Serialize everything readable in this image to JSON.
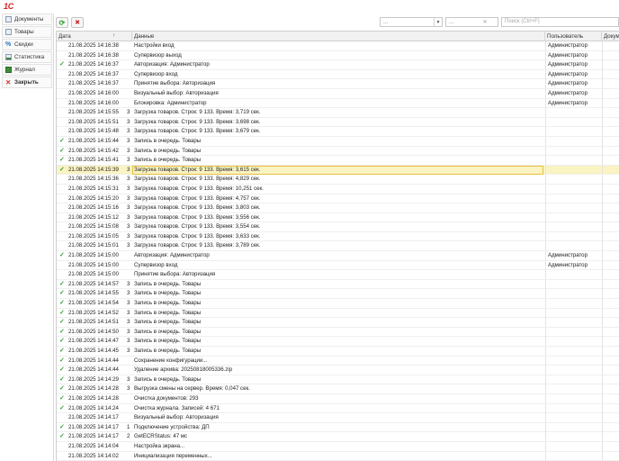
{
  "app": {
    "logo_text": "1С"
  },
  "sidebar": {
    "items": [
      {
        "label": "Документы",
        "icon": "documents-icon"
      },
      {
        "label": "Товары",
        "icon": "goods-icon"
      },
      {
        "label": "Скидки",
        "icon": "percent-icon"
      },
      {
        "label": "Статистика",
        "icon": "chart-icon"
      },
      {
        "label": "Журнал",
        "icon": "journal-icon"
      },
      {
        "label": "Закрыть",
        "icon": "close-icon"
      }
    ]
  },
  "toolbar": {
    "filter1_value": "...",
    "filter2_value": "...",
    "search_placeholder": "Поиск (Ctrl+F)"
  },
  "table": {
    "columns": {
      "date": "Дата",
      "data": "Данные",
      "user": "Пользователь",
      "doc": "Докуме"
    },
    "sort_indicator": "↑",
    "rows": [
      {
        "check": false,
        "date": "21.08.2025 14:16:38",
        "code": "",
        "data": "Настройки вход",
        "user": "Администратор"
      },
      {
        "check": false,
        "date": "21.08.2025 14:16:38",
        "code": "",
        "data": "Супервизор выход",
        "user": "Администратор"
      },
      {
        "check": true,
        "date": "21.08.2025 14:16:37",
        "code": "",
        "data": "Авторизация: Администратор",
        "user": "Администратор"
      },
      {
        "check": false,
        "date": "21.08.2025 14:16:37",
        "code": "",
        "data": "Супервизор вход",
        "user": "Администратор"
      },
      {
        "check": false,
        "date": "21.08.2025 14:16:37",
        "code": "",
        "data": "Принятие выбора: Авторизация",
        "user": "Администратор"
      },
      {
        "check": false,
        "date": "21.08.2025 14:16:00",
        "code": "",
        "data": "Визуальный выбор: Авторизация",
        "user": "Администратор"
      },
      {
        "check": false,
        "date": "21.08.2025 14:16:00",
        "code": "",
        "data": "Блокировка: Администратор",
        "user": "Администратор"
      },
      {
        "check": false,
        "date": "21.08.2025 14:15:55",
        "code": "3",
        "data": "Загрузка товаров. Строк: 9 133. Время: 3,719 сек.",
        "user": ""
      },
      {
        "check": false,
        "date": "21.08.2025 14:15:51",
        "code": "3",
        "data": "Загрузка товаров. Строк: 9 133. Время: 3,698 сек.",
        "user": ""
      },
      {
        "check": false,
        "date": "21.08.2025 14:15:48",
        "code": "3",
        "data": "Загрузка товаров. Строк: 9 133. Время: 3,679 сек.",
        "user": ""
      },
      {
        "check": true,
        "date": "21.08.2025 14:15:44",
        "code": "3",
        "data": "Запись в очередь. Товары",
        "user": ""
      },
      {
        "check": true,
        "date": "21.08.2025 14:15:42",
        "code": "3",
        "data": "Запись в очередь. Товары",
        "user": ""
      },
      {
        "check": true,
        "date": "21.08.2025 14:15:41",
        "code": "3",
        "data": "Запись в очередь. Товары",
        "user": ""
      },
      {
        "check": true,
        "date": "21.08.2025 14:15:39",
        "code": "3",
        "data": "Загрузка товаров. Строк: 9 133. Время: 3,615 сек.",
        "user": "",
        "selected": true
      },
      {
        "check": false,
        "date": "21.08.2025 14:15:36",
        "code": "3",
        "data": "Загрузка товаров. Строк: 9 133. Время: 4,829 сек.",
        "user": ""
      },
      {
        "check": false,
        "date": "21.08.2025 14:15:31",
        "code": "3",
        "data": "Загрузка товаров. Строк: 9 133. Время: 10,251 сек.",
        "user": ""
      },
      {
        "check": false,
        "date": "21.08.2025 14:15:20",
        "code": "3",
        "data": "Загрузка товаров. Строк: 9 133. Время: 4,757 сек.",
        "user": ""
      },
      {
        "check": false,
        "date": "21.08.2025 14:15:16",
        "code": "3",
        "data": "Загрузка товаров. Строк: 9 133. Время: 3,803 сек.",
        "user": ""
      },
      {
        "check": false,
        "date": "21.08.2025 14:15:12",
        "code": "3",
        "data": "Загрузка товаров. Строк: 9 133. Время: 3,556 сек.",
        "user": ""
      },
      {
        "check": false,
        "date": "21.08.2025 14:15:08",
        "code": "3",
        "data": "Загрузка товаров. Строк: 9 133. Время: 3,554 сек.",
        "user": ""
      },
      {
        "check": false,
        "date": "21.08.2025 14:15:05",
        "code": "3",
        "data": "Загрузка товаров. Строк: 9 133. Время: 3,633 сек.",
        "user": ""
      },
      {
        "check": false,
        "date": "21.08.2025 14:15:01",
        "code": "3",
        "data": "Загрузка товаров. Строк: 9 133. Время: 3,789 сек.",
        "user": ""
      },
      {
        "check": true,
        "date": "21.08.2025 14:15:00",
        "code": "",
        "data": "Авторизация: Администратор",
        "user": "Администратор"
      },
      {
        "check": false,
        "date": "21.08.2025 14:15:00",
        "code": "",
        "data": "Супервизор вход",
        "user": "Администратор"
      },
      {
        "check": false,
        "date": "21.08.2025 14:15:00",
        "code": "",
        "data": "Принятие выбора: Авторизация",
        "user": ""
      },
      {
        "check": true,
        "date": "21.08.2025 14:14:57",
        "code": "3",
        "data": "Запись в очередь. Товары",
        "user": ""
      },
      {
        "check": true,
        "date": "21.08.2025 14:14:55",
        "code": "3",
        "data": "Запись в очередь. Товары",
        "user": ""
      },
      {
        "check": true,
        "date": "21.08.2025 14:14:54",
        "code": "3",
        "data": "Запись в очередь. Товары",
        "user": ""
      },
      {
        "check": true,
        "date": "21.08.2025 14:14:52",
        "code": "3",
        "data": "Запись в очередь. Товары",
        "user": ""
      },
      {
        "check": true,
        "date": "21.08.2025 14:14:51",
        "code": "3",
        "data": "Запись в очередь. Товары",
        "user": ""
      },
      {
        "check": true,
        "date": "21.08.2025 14:14:50",
        "code": "3",
        "data": "Запись в очередь. Товары",
        "user": ""
      },
      {
        "check": true,
        "date": "21.08.2025 14:14:47",
        "code": "3",
        "data": "Запись в очередь. Товары",
        "user": ""
      },
      {
        "check": true,
        "date": "21.08.2025 14:14:45",
        "code": "3",
        "data": "Запись в очередь. Товары",
        "user": ""
      },
      {
        "check": true,
        "date": "21.08.2025 14:14:44",
        "code": "",
        "data": "Сохранение конфигурации...",
        "user": ""
      },
      {
        "check": true,
        "date": "21.08.2025 14:14:44",
        "code": "",
        "data": "Удаление архива: 20250818005336.zip",
        "user": ""
      },
      {
        "check": true,
        "date": "21.08.2025 14:14:29",
        "code": "3",
        "data": "Запись в очередь. Товары",
        "user": ""
      },
      {
        "check": true,
        "date": "21.08.2025 14:14:28",
        "code": "3",
        "data": "Выгрузка смены на сервер. Время: 0,047 сек.",
        "user": ""
      },
      {
        "check": true,
        "date": "21.08.2025 14:14:28",
        "code": "",
        "data": "Очистка документов: 293",
        "user": ""
      },
      {
        "check": true,
        "date": "21.08.2025 14:14:24",
        "code": "",
        "data": "Очистка журнала. Записей: 4 671",
        "user": ""
      },
      {
        "check": false,
        "date": "21.08.2025 14:14:17",
        "code": "",
        "data": "Визуальный выбор: Авторизация",
        "user": ""
      },
      {
        "check": true,
        "date": "21.08.2025 14:14:17",
        "code": "1",
        "data": "Подключение устройства: ДП",
        "user": ""
      },
      {
        "check": true,
        "date": "21.08.2025 14:14:17",
        "code": "2",
        "data": "GetECRStatus: 47 мс",
        "user": ""
      },
      {
        "check": false,
        "date": "21.08.2025 14:14:04",
        "code": "",
        "data": "Настройка экрана...",
        "user": ""
      },
      {
        "check": false,
        "date": "21.08.2025 14:14:02",
        "code": "",
        "data": "Инициализация переменных...",
        "user": ""
      }
    ]
  }
}
